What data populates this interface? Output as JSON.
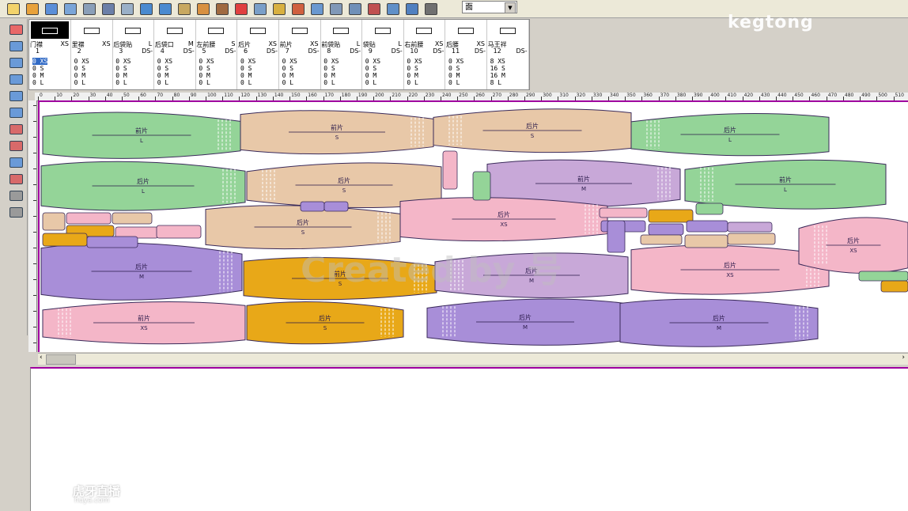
{
  "toolbar": {
    "icons": [
      "new-file-icon",
      "open-folder-icon",
      "export-icon",
      "save-icon",
      "print-setup-icon",
      "print-icon",
      "print-preview-icon",
      "undo-icon",
      "redo-icon",
      "import-icon",
      "edit-pen-icon",
      "tools-icon",
      "color-wheel-icon",
      "table-icon",
      "text-icon",
      "measure-icon",
      "layout-icon",
      "report-icon",
      "calculator-icon",
      "warning-icon",
      "piece-icon",
      "plot-icon",
      "delete-icon"
    ],
    "fabric_select": "面"
  },
  "watermark": "kegtong",
  "left_tools": [
    "color-palette-icon",
    "ruler-icon",
    "rotate-piece-icon",
    "flip-piece-icon",
    "move-piece-icon",
    "spacing-icon",
    "fold-icon",
    "split-icon",
    "join-icon",
    "cut-icon",
    "zoom-icon",
    "zoom-fit-icon"
  ],
  "piece_list": [
    {
      "name": "门襟",
      "size": "XS",
      "num": "1",
      "ds": "",
      "rows": [
        "0 XS",
        "0 S",
        "0 M",
        "0 L"
      ],
      "selected": true
    },
    {
      "name": "里襟",
      "size": "XS",
      "num": "2",
      "ds": "",
      "rows": [
        "0 XS",
        "0 S",
        "0 M",
        "0 L"
      ]
    },
    {
      "name": "后袋贴",
      "size": "L",
      "num": "3",
      "ds": "DS-",
      "rows": [
        "0 XS",
        "0 S",
        "0 M",
        "0 L"
      ]
    },
    {
      "name": "后袋口",
      "size": "M",
      "num": "4",
      "ds": "DS-",
      "rows": [
        "0 XS",
        "0 S",
        "0 M",
        "0 L"
      ]
    },
    {
      "name": "左前腰",
      "size": "S",
      "num": "5",
      "ds": "DS-",
      "rows": [
        "0 XS",
        "0 S",
        "0 M",
        "0 L"
      ]
    },
    {
      "name": "后片",
      "size": "XS",
      "num": "6",
      "ds": "DS-",
      "rows": [
        "0 XS",
        "0 S",
        "0 M",
        "0 L"
      ]
    },
    {
      "name": "前片",
      "size": "XS",
      "num": "7",
      "ds": "DS-",
      "rows": [
        "0 XS",
        "0 S",
        "0 M",
        "0 L"
      ]
    },
    {
      "name": "前袋贴",
      "size": "L",
      "num": "8",
      "ds": "DS-",
      "rows": [
        "0 XS",
        "0 S",
        "0 M",
        "0 L"
      ]
    },
    {
      "name": "袋贴",
      "size": "L",
      "num": "9",
      "ds": "DS-",
      "rows": [
        "0 XS",
        "0 S",
        "0 M",
        "0 L"
      ]
    },
    {
      "name": "右前腰",
      "size": "XS",
      "num": "10",
      "ds": "DS-",
      "rows": [
        "0 XS",
        "0 S",
        "0 M",
        "0 L"
      ]
    },
    {
      "name": "后腰",
      "size": "XS",
      "num": "11",
      "ds": "DS-",
      "rows": [
        "0 XS",
        "0 S",
        "0 M",
        "0 L"
      ]
    },
    {
      "name": "马王袢",
      "size": "",
      "num": "12",
      "ds": "DS-",
      "rows": [
        "8 XS",
        "16 S",
        "16 M",
        "8 L"
      ]
    }
  ],
  "ruler": {
    "start": 0,
    "end": 510,
    "step": 10
  },
  "marker": {
    "watermark": "Created by 号",
    "colors": {
      "XS": "#f4b6c8",
      "S": "#e8c8a8",
      "M": "#a88ed8",
      "L": "#94d498",
      "Y": "#e8a818",
      "P": "#c8a8d8"
    },
    "pieces": [
      {
        "label": "前片",
        "size": "L",
        "color": "L",
        "fold": false
      },
      {
        "label": "前片",
        "size": "S",
        "color": "S",
        "fold": false
      },
      {
        "label": "后片",
        "size": "S",
        "color": "S",
        "fold": false
      },
      {
        "label": "后片",
        "size": "L",
        "color": "L",
        "fold": true
      },
      {
        "label": "后片",
        "size": "L",
        "color": "L",
        "fold": true
      },
      {
        "label": "后片",
        "size": "S",
        "color": "S",
        "fold": true
      },
      {
        "label": "前片",
        "size": "M",
        "color": "P",
        "fold": false
      },
      {
        "label": "前片",
        "size": "L",
        "color": "L",
        "fold": false
      },
      {
        "label": "后片",
        "size": "S",
        "color": "S",
        "fold": true
      },
      {
        "label": "后片",
        "size": "XS",
        "color": "XS",
        "fold": true
      },
      {
        "label": "后片",
        "size": "M",
        "color": "M",
        "fold": false
      },
      {
        "label": "前片",
        "size": "S",
        "color": "Y",
        "fold": false
      },
      {
        "label": "后片",
        "size": "M",
        "color": "P",
        "fold": true
      },
      {
        "label": "后片",
        "size": "XS",
        "color": "XS",
        "fold": false
      },
      {
        "label": "后片",
        "size": "XS",
        "color": "XS",
        "fold": true
      },
      {
        "label": "前片",
        "size": "XS",
        "color": "XS",
        "fold": false
      },
      {
        "label": "后片",
        "size": "S",
        "color": "Y",
        "fold": true
      },
      {
        "label": "后片",
        "size": "M",
        "color": "M",
        "fold": true
      },
      {
        "label": "后片",
        "size": "M",
        "color": "M",
        "fold": false
      }
    ]
  },
  "logo": {
    "name": "虎牙直播",
    "url": "huya.com"
  }
}
